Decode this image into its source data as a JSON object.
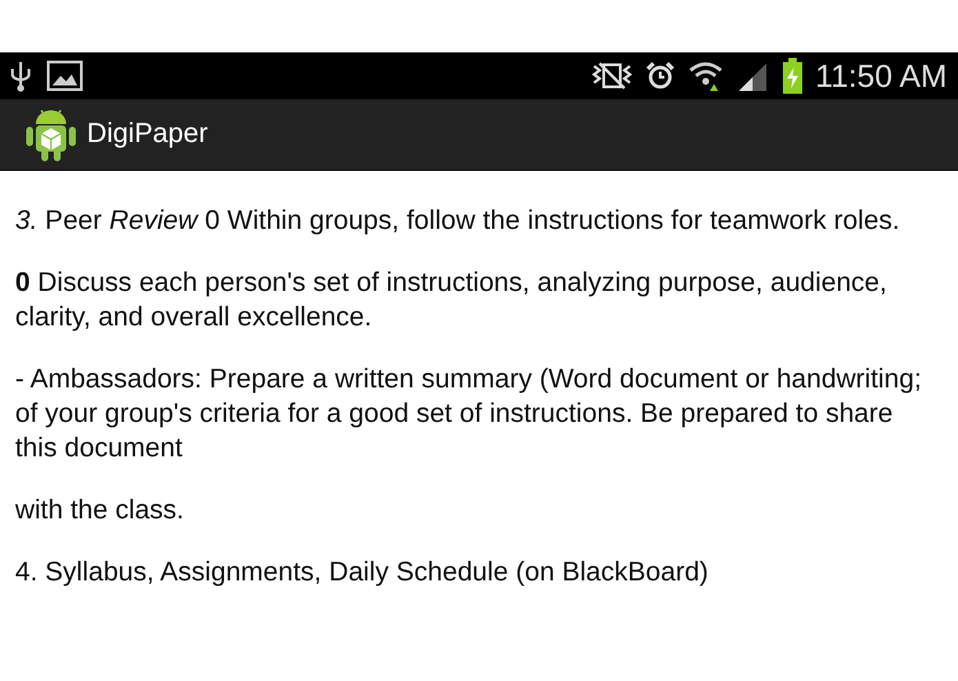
{
  "status_bar": {
    "time": "11:50 AM"
  },
  "app_bar": {
    "title": "DigiPaper"
  },
  "content": {
    "paragraphs": [
      "*3.* Peer *Review* 0 Within groups, follow the instructions for teamwork roles.",
      "**0** Discuss each person's set of instructions, analyzing purpose, audience, clarity, and overall excellence.",
      "- Ambassadors: Prepare a written summary (Word document or handwriting; of your group's criteria for a good set of instructions. Be prepared to share this document",
      "with the class.",
      "4. Syllabus, Assignments, Daily Schedule (on BlackBoard)"
    ]
  }
}
